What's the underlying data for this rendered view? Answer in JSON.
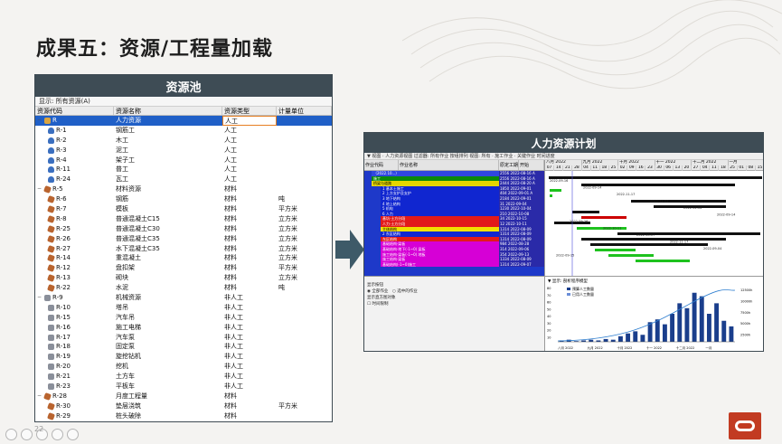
{
  "slide": {
    "title": "成果五：资源/工程量加载",
    "page": "22"
  },
  "resource_pool": {
    "header": "资源池",
    "filter": "显示: 所有资源(A)",
    "columns": [
      "资源代码",
      "资源名称",
      "资源类型",
      "计量单位"
    ],
    "rows": [
      {
        "code": "R",
        "name": "人力资源",
        "type": "人工",
        "unit": "",
        "indent": 0,
        "icon": "group-icon",
        "sel": true,
        "exp": "−"
      },
      {
        "code": "R-1",
        "name": "钢筋工",
        "type": "人工",
        "unit": "",
        "indent": 1,
        "icon": "person-icon"
      },
      {
        "code": "R-2",
        "name": "木工",
        "type": "人工",
        "unit": "",
        "indent": 1,
        "icon": "person-icon"
      },
      {
        "code": "R-3",
        "name": "泥工",
        "type": "人工",
        "unit": "",
        "indent": 1,
        "icon": "person-icon"
      },
      {
        "code": "R-4",
        "name": "架子工",
        "type": "人工",
        "unit": "",
        "indent": 1,
        "icon": "person-icon"
      },
      {
        "code": "R-11",
        "name": "普工",
        "type": "人工",
        "unit": "",
        "indent": 1,
        "icon": "person-icon"
      },
      {
        "code": "R-24",
        "name": "瓦工",
        "type": "人工",
        "unit": "",
        "indent": 1,
        "icon": "person-icon"
      },
      {
        "code": "R-5",
        "name": "材料资源",
        "type": "材料",
        "unit": "",
        "indent": 0,
        "icon": "material-icon",
        "exp": "−"
      },
      {
        "code": "R-6",
        "name": "钢筋",
        "type": "材料",
        "unit": "吨",
        "indent": 1,
        "icon": "material-icon"
      },
      {
        "code": "R-7",
        "name": "模板",
        "type": "材料",
        "unit": "平方米",
        "indent": 1,
        "icon": "material-icon"
      },
      {
        "code": "R-8",
        "name": "普通混凝土C15",
        "type": "材料",
        "unit": "立方米",
        "indent": 1,
        "icon": "material-icon"
      },
      {
        "code": "R-25",
        "name": "普通混凝土C30",
        "type": "材料",
        "unit": "立方米",
        "indent": 1,
        "icon": "material-icon"
      },
      {
        "code": "R-26",
        "name": "普通混凝土C35",
        "type": "材料",
        "unit": "立方米",
        "indent": 1,
        "icon": "material-icon"
      },
      {
        "code": "R-27",
        "name": "水下混凝土C35",
        "type": "材料",
        "unit": "立方米",
        "indent": 1,
        "icon": "material-icon"
      },
      {
        "code": "R-14",
        "name": "重混凝土",
        "type": "材料",
        "unit": "立方米",
        "indent": 1,
        "icon": "material-icon"
      },
      {
        "code": "R-12",
        "name": "盘扣架",
        "type": "材料",
        "unit": "平方米",
        "indent": 1,
        "icon": "material-icon"
      },
      {
        "code": "R-13",
        "name": "砌块",
        "type": "材料",
        "unit": "立方米",
        "indent": 1,
        "icon": "material-icon"
      },
      {
        "code": "R-22",
        "name": "水泥",
        "type": "材料",
        "unit": "吨",
        "indent": 1,
        "icon": "material-icon"
      },
      {
        "code": "R-9",
        "name": "机械资源",
        "type": "非人工",
        "unit": "",
        "indent": 0,
        "icon": "machine-icon",
        "exp": "−"
      },
      {
        "code": "R-10",
        "name": "塔吊",
        "type": "非人工",
        "unit": "",
        "indent": 1,
        "icon": "machine-icon"
      },
      {
        "code": "R-15",
        "name": "汽车吊",
        "type": "非人工",
        "unit": "",
        "indent": 1,
        "icon": "machine-icon"
      },
      {
        "code": "R-16",
        "name": "施工电梯",
        "type": "非人工",
        "unit": "",
        "indent": 1,
        "icon": "machine-icon"
      },
      {
        "code": "R-17",
        "name": "汽车泵",
        "type": "非人工",
        "unit": "",
        "indent": 1,
        "icon": "machine-icon"
      },
      {
        "code": "R-18",
        "name": "固定泵",
        "type": "非人工",
        "unit": "",
        "indent": 1,
        "icon": "machine-icon"
      },
      {
        "code": "R-19",
        "name": "旋挖钻机",
        "type": "非人工",
        "unit": "",
        "indent": 1,
        "icon": "machine-icon"
      },
      {
        "code": "R-20",
        "name": "挖机",
        "type": "非人工",
        "unit": "",
        "indent": 1,
        "icon": "machine-icon"
      },
      {
        "code": "R-21",
        "name": "土方车",
        "type": "非人工",
        "unit": "",
        "indent": 1,
        "icon": "machine-icon"
      },
      {
        "code": "R-23",
        "name": "平板车",
        "type": "非人工",
        "unit": "",
        "indent": 1,
        "icon": "machine-icon"
      },
      {
        "code": "R-28",
        "name": "月度工程量",
        "type": "材料",
        "unit": "",
        "indent": 0,
        "icon": "material-icon",
        "exp": "−"
      },
      {
        "code": "R-30",
        "name": "垫层浇筑",
        "type": "材料",
        "unit": "平方米",
        "indent": 1,
        "icon": "material-icon"
      },
      {
        "code": "R-29",
        "name": "桩头破除",
        "type": "材料",
        "unit": "",
        "indent": 1,
        "icon": "material-icon"
      }
    ]
  },
  "resource_plan": {
    "header": "人力资源计划",
    "toolbar": "▼ 视图 · 人力资源视图    过滤器: 所有作业    按组排列    视图: 所有 · 施工作业 · 关键作业    时间进度",
    "wbs_header": [
      "作业代码",
      "作业名称",
      "原定工期",
      "开始"
    ],
    "wbs_rows": [
      {
        "name": "（2022.10...）",
        "val": "2556  2022-08-16 A",
        "color": "#3046e0"
      },
      {
        "name": "施工",
        "val": "2556  2022-08-16 A",
        "color": "#0a8a0a"
      },
      {
        "name": "桥梁与道路",
        "val": "2444  2022-08-20 A",
        "color": "#e5d600",
        "text": "#000"
      },
      {
        "name": "1 基本土施工",
        "val": "1850  2022-09-01",
        "color": "#1026d0"
      },
      {
        "name": "2 上方支护及支护",
        "val": "404  2022-09-01 A",
        "color": "#1026d0"
      },
      {
        "name": "3 地下结构",
        "val": "2184  2022-09-01",
        "color": "#1026d0"
      },
      {
        "name": "4 地上结构",
        "val": "31  2022-09-04",
        "color": "#1026d0"
      },
      {
        "name": "5 机电",
        "val": "1230  2022-10-04",
        "color": "#1026d0"
      },
      {
        "name": "6 人力",
        "val": "210  2022-10-08",
        "color": "#1026d0"
      },
      {
        "name": "基坑·土方分段",
        "val": "34  2022-10-15",
        "color": "#e21a1a"
      },
      {
        "name": "人力·土方分段",
        "val": "12  2022-10-11",
        "color": "#e21a1a"
      },
      {
        "name": "主体结构",
        "val": "1314  2022-08-09",
        "color": "#f1e100",
        "text": "#000"
      },
      {
        "name": "2 东区结构",
        "val": "1314  2022-08-09",
        "color": "#1026d0"
      },
      {
        "name": "东区结构",
        "val": "1314  2022-08-09",
        "color": "#e21a1a"
      },
      {
        "name": "基础结构·梁板",
        "val": "984  2022-08-28",
        "color": "#d600d6"
      },
      {
        "name": "基础结构·地下(-1~0) 梁板",
        "val": "314  2022-09-06",
        "color": "#d600d6"
      },
      {
        "name": "施工结构·梁板(-1~0) 地板",
        "val": "354  2022-09-13",
        "color": "#d600d6"
      },
      {
        "name": "施工结构·梁板",
        "val": "1334  2022-08-09",
        "color": "#d600d6"
      },
      {
        "name": "基础结构(-1~0)施工",
        "val": "1314  2022-09-07",
        "color": "#d600d6"
      }
    ],
    "gantt_months": [
      "八月 2022",
      "九月 2022",
      "十月 2022",
      "十一 2022",
      "十二月 2022",
      "一月"
    ],
    "gantt_days": [
      "07",
      "14",
      "21",
      "28",
      "04",
      "11",
      "18",
      "25",
      "02",
      "09",
      "16",
      "23",
      "30",
      "06",
      "13",
      "20",
      "27",
      "04",
      "11",
      "18",
      "25",
      "01",
      "08",
      "15"
    ],
    "gantt_labels": [
      "2022-09-16",
      "2022-09-14",
      "2022-11-17",
      "2022-12-01",
      "2022-12-06",
      "2022-09-14",
      "2022-09-26",
      "2022-10-11",
      "2022-10-07",
      "2022-11-17",
      "2022-09-04",
      "2022-09-15"
    ],
    "bottom_options": {
      "title": "显示按钮",
      "opt1": "全部作业",
      "opt2": "选中的作业",
      "title2": "显示直方图对象",
      "opt3": "时间限制"
    },
    "histogram": {
      "toolbar": "▼ 显示: 剖析程序模型",
      "legend": [
        "预算人工数量",
        "已用人工数量"
      ],
      "y_left": [
        "80",
        "70",
        "60",
        "50",
        "40",
        "30",
        "20",
        "10"
      ],
      "y_right": [
        "12500h",
        "10000h",
        "7500h",
        "5000h",
        "2500h"
      ],
      "bars": [
        2,
        3,
        1,
        2,
        3,
        2,
        4,
        3,
        8,
        12,
        15,
        10,
        28,
        32,
        25,
        40,
        55,
        48,
        70,
        65,
        40,
        55,
        30,
        22
      ]
    }
  },
  "colors": {
    "panel_header": "#3e4c55",
    "accent": "#1f5fc7",
    "arrow": "#3e5a68",
    "logo": "#c23b22"
  }
}
